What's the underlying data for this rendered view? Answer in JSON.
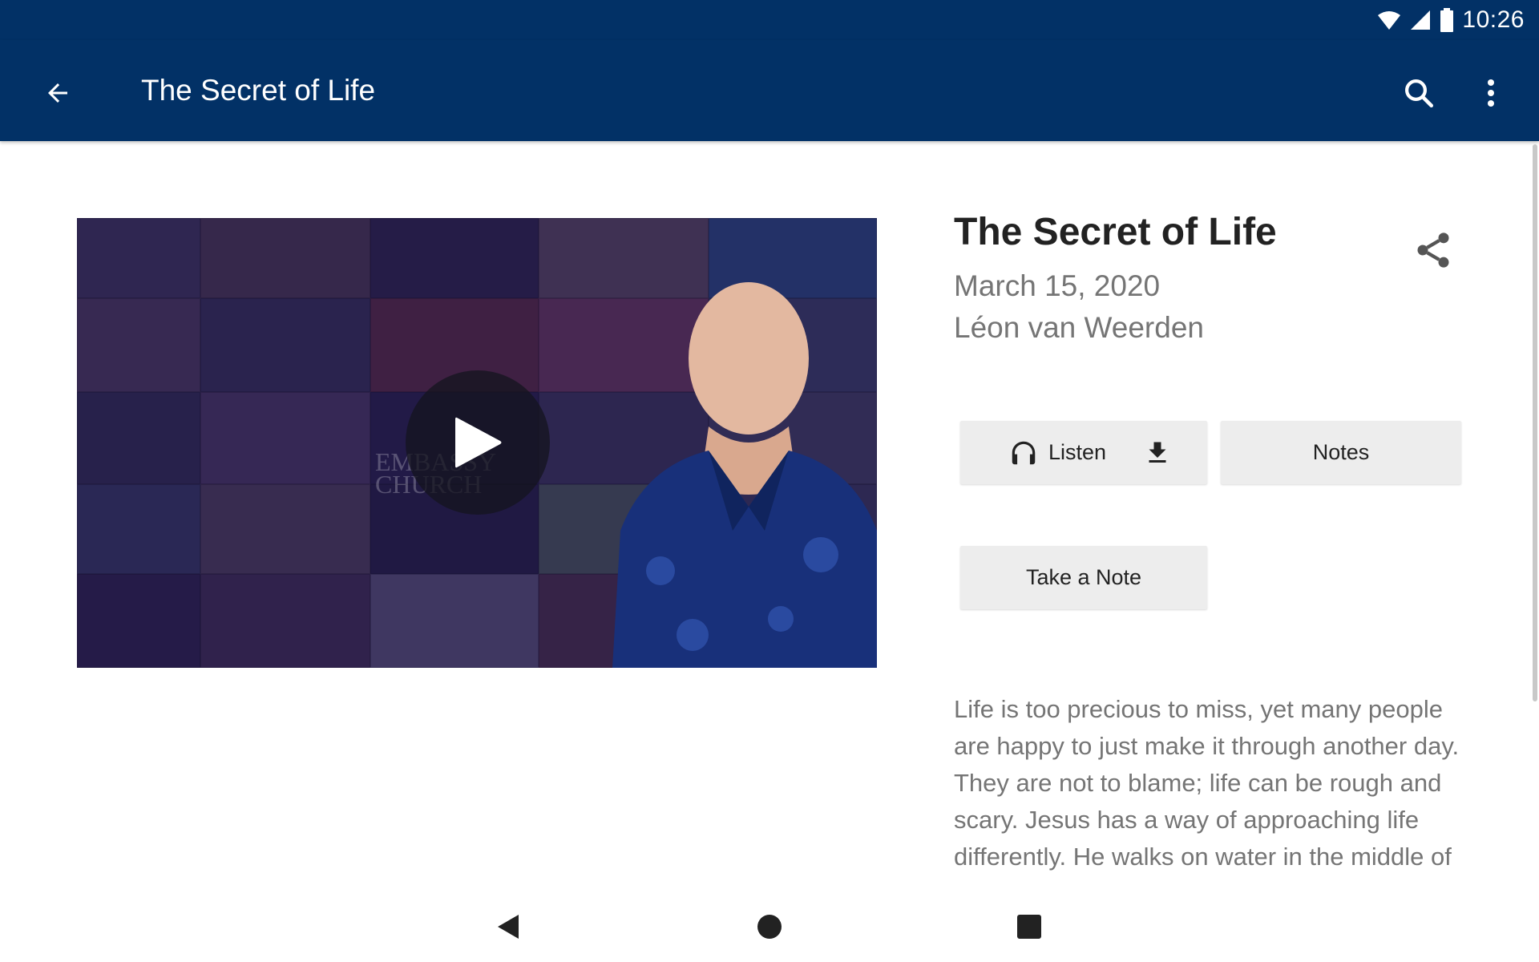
{
  "status_bar": {
    "time": "10:26",
    "icons": [
      "wifi-icon",
      "signal-icon",
      "battery-icon"
    ]
  },
  "app_bar": {
    "title": "The Secret of Life",
    "icons": [
      "back-arrow-icon",
      "search-icon",
      "more-vert-icon"
    ]
  },
  "video": {
    "watermark": "EMBASSY\nCHURCH",
    "play_icon": "play-icon"
  },
  "sermon": {
    "title": "The Secret of Life",
    "date": "March 15, 2020",
    "speaker": "Léon van Weerden",
    "share_icon": "share-icon"
  },
  "actions": {
    "listen_label": "Listen",
    "notes_label": "Notes",
    "take_note_label": "Take a Note",
    "icons": [
      "headphones-icon",
      "download-icon"
    ]
  },
  "description": "Life is too precious to miss, yet many people are happy to just make it through another day. They are not to blame; life can be rough and scary. Jesus has a way of approaching life differently. He walks on water in the middle of the storm and doesn't allow",
  "nav": {
    "icons": [
      "nav-back-icon",
      "nav-home-icon",
      "nav-recents-icon"
    ]
  },
  "colors": {
    "brand": "#023166",
    "button_bg": "#ededed",
    "secondary_text": "#757575"
  }
}
